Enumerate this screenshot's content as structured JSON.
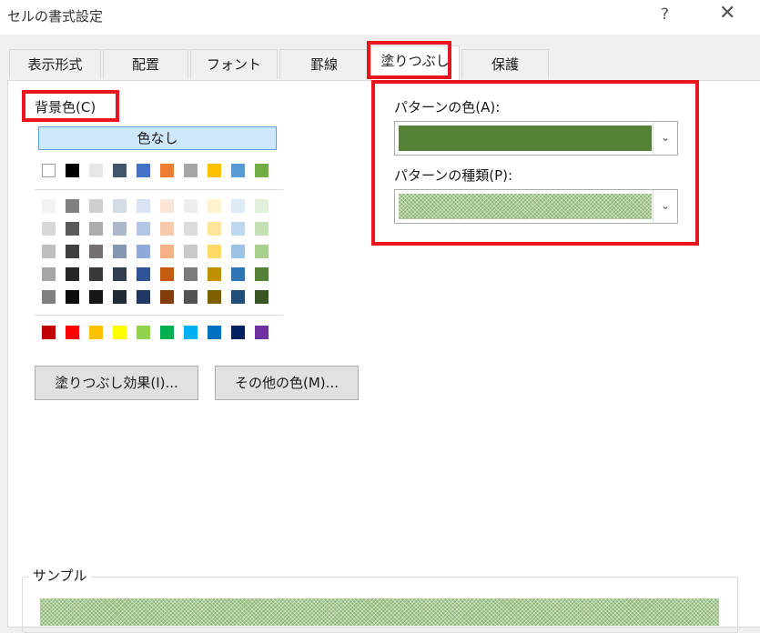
{
  "window": {
    "title": "セルの書式設定",
    "help": "?",
    "close": "✕"
  },
  "tabs": [
    "表示形式",
    "配置",
    "フォント",
    "罫線",
    "塗りつぶし",
    "保護"
  ],
  "background": {
    "label": "背景色(C)",
    "no_color": "色なし",
    "theme_top": [
      "#ffffff",
      "#000000",
      "#e7e6e6",
      "#44546a",
      "#4472c4",
      "#ed7d31",
      "#a5a5a5",
      "#ffc000",
      "#5b9bd5",
      "#70ad47"
    ],
    "shades": [
      [
        "#f2f2f2",
        "#808080",
        "#d0cece",
        "#d6dce4",
        "#d9e2f3",
        "#fbe5d5",
        "#ededed",
        "#fff2cc",
        "#deebf6",
        "#e2efd9"
      ],
      [
        "#d8d8d8",
        "#595959",
        "#aeabab",
        "#adb9ca",
        "#b4c6e7",
        "#f7caac",
        "#dbdbdb",
        "#ffe599",
        "#bdd7ee",
        "#c5e0b3"
      ],
      [
        "#bfbfbf",
        "#3f3f3f",
        "#757070",
        "#8496b0",
        "#8eaadb",
        "#f4b183",
        "#c9c9c9",
        "#ffd966",
        "#9cc3e5",
        "#a8d08d"
      ],
      [
        "#a5a5a5",
        "#262626",
        "#3a3838",
        "#323f4f",
        "#2f5496",
        "#c55a11",
        "#7b7b7b",
        "#bf9000",
        "#2e75b5",
        "#538135"
      ],
      [
        "#7f7f7f",
        "#0c0c0c",
        "#171616",
        "#222a35",
        "#1f3864",
        "#833c0b",
        "#525252",
        "#7f6000",
        "#1f4e79",
        "#375623"
      ]
    ],
    "standard": [
      "#c00000",
      "#ff0000",
      "#ffc000",
      "#ffff00",
      "#92d050",
      "#00b050",
      "#00b0f0",
      "#0070c0",
      "#002060",
      "#7030a0"
    ],
    "fill_effects_button": "塗りつぶし効果(I)...",
    "more_colors_button": "その他の色(M)..."
  },
  "pattern": {
    "color_label": "パターンの色(A):",
    "color_value": "#538135",
    "style_label": "パターンの種類(P):"
  },
  "sample": {
    "label": "サンプル"
  },
  "highlight_color": "#e8141e"
}
